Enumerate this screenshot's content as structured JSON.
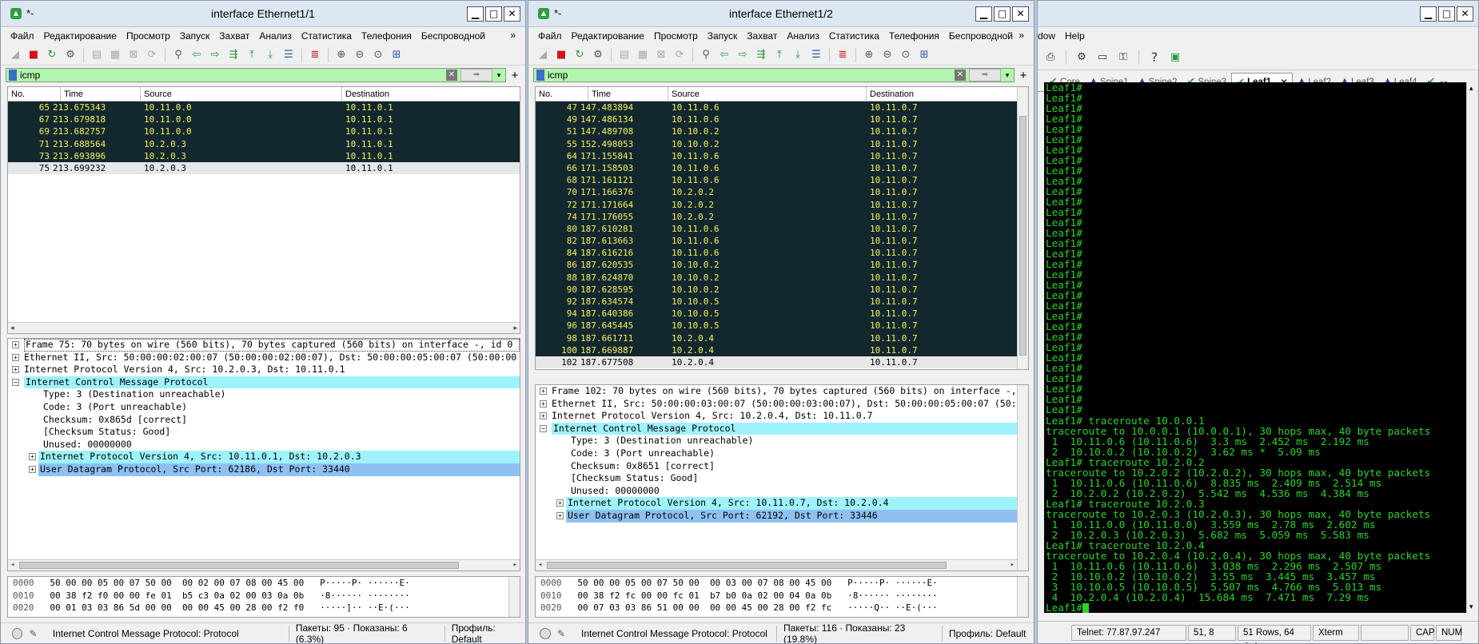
{
  "menu": [
    "Файл",
    "Редактирование",
    "Просмотр",
    "Запуск",
    "Захват",
    "Анализ",
    "Статистика",
    "Телефония",
    "Беспроводной"
  ],
  "columns": {
    "no": "No.",
    "time": "Time",
    "source": "Source",
    "destination": "Destination"
  },
  "win1": {
    "app_name": "*-",
    "title": "interface Ethernet1/1",
    "filter": "icmp",
    "packets": [
      {
        "no": "65",
        "time": "213.675343",
        "src": "10.11.0.0",
        "dst": "10.11.0.1",
        "style": "dark"
      },
      {
        "no": "67",
        "time": "213.679818",
        "src": "10.11.0.0",
        "dst": "10.11.0.1",
        "style": "dark"
      },
      {
        "no": "69",
        "time": "213.682757",
        "src": "10.11.0.0",
        "dst": "10.11.0.1",
        "style": "dark"
      },
      {
        "no": "71",
        "time": "213.688564",
        "src": "10.2.0.3",
        "dst": "10.11.0.1",
        "style": "dark"
      },
      {
        "no": "73",
        "time": "213.693896",
        "src": "10.2.0.3",
        "dst": "10.11.0.1",
        "style": "dark"
      },
      {
        "no": "75",
        "time": "213.699232",
        "src": "10.2.0.3",
        "dst": "10.11.0.1",
        "style": "sel"
      }
    ],
    "details": [
      {
        "text": "Frame 75: 70 bytes on wire (560 bits), 70 bytes captured (560 bits) on interface -, id 0",
        "level": "top",
        "expander": "+",
        "hl": "outline"
      },
      {
        "text": "Ethernet II, Src: 50:00:00:02:00:07 (50:00:00:02:00:07), Dst: 50:00:00:05:00:07 (50:00:00",
        "level": "top",
        "expander": "+",
        "hl": ""
      },
      {
        "text": "Internet Protocol Version 4, Src: 10.2.0.3, Dst: 10.11.0.1",
        "level": "top",
        "expander": "+",
        "hl": ""
      },
      {
        "text": "Internet Control Message Protocol",
        "level": "top",
        "expander": "−",
        "hl": "cyan"
      },
      {
        "text": "Type: 3 (Destination unreachable)",
        "level": "child",
        "expander": "",
        "hl": ""
      },
      {
        "text": "Code: 3 (Port unreachable)",
        "level": "child",
        "expander": "",
        "hl": ""
      },
      {
        "text": "Checksum: 0x865d [correct]",
        "level": "child",
        "expander": "",
        "hl": ""
      },
      {
        "text": "[Checksum Status: Good]",
        "level": "child",
        "expander": "",
        "hl": ""
      },
      {
        "text": "Unused: 00000000",
        "level": "child",
        "expander": "",
        "hl": ""
      },
      {
        "text": "Internet Protocol Version 4, Src: 10.11.0.1, Dst: 10.2.0.3",
        "level": "child2",
        "expander": "+",
        "hl": "cyan"
      },
      {
        "text": "User Datagram Protocol, Src Port: 62186, Dst Port: 33440",
        "level": "child2",
        "expander": "+",
        "hl": "blue"
      }
    ],
    "hex": [
      {
        "off": "0000",
        "bytes": "50 00 00 05 00 07 50 00  00 02 00 07 08 00 45 00",
        "ascii": "P·····P· ······E·"
      },
      {
        "off": "0010",
        "bytes": "00 38 f2 f0 00 00 fe 01  b5 c3 0a 02 00 03 0a 0b",
        "ascii": "·8······ ········"
      },
      {
        "off": "0020",
        "bytes": "00 01 03 03 86 5d 00 00  00 00 45 00 28 00 f2 f0",
        "ascii": "·····]·· ··E·(···"
      }
    ],
    "status": {
      "field": "Internet Control Message Protocol: Protocol",
      "packets": "Пакеты: 95 · Показаны: 6 (6.3%)",
      "profile": "Профиль: Default"
    }
  },
  "win2": {
    "app_name": "*-",
    "title": "interface Ethernet1/2",
    "filter": "icmp",
    "packets": [
      {
        "no": "47",
        "time": "147.483894",
        "src": "10.11.0.6",
        "dst": "10.11.0.7",
        "style": "dark"
      },
      {
        "no": "49",
        "time": "147.486134",
        "src": "10.11.0.6",
        "dst": "10.11.0.7",
        "style": "dark"
      },
      {
        "no": "51",
        "time": "147.489708",
        "src": "10.10.0.2",
        "dst": "10.11.0.7",
        "style": "dark"
      },
      {
        "no": "55",
        "time": "152.498053",
        "src": "10.10.0.2",
        "dst": "10.11.0.7",
        "style": "dark"
      },
      {
        "no": "64",
        "time": "171.155841",
        "src": "10.11.0.6",
        "dst": "10.11.0.7",
        "style": "dark"
      },
      {
        "no": "66",
        "time": "171.158503",
        "src": "10.11.0.6",
        "dst": "10.11.0.7",
        "style": "dark"
      },
      {
        "no": "68",
        "time": "171.161121",
        "src": "10.11.0.6",
        "dst": "10.11.0.7",
        "style": "dark"
      },
      {
        "no": "70",
        "time": "171.166376",
        "src": "10.2.0.2",
        "dst": "10.11.0.7",
        "style": "dark"
      },
      {
        "no": "72",
        "time": "171.171664",
        "src": "10.2.0.2",
        "dst": "10.11.0.7",
        "style": "dark"
      },
      {
        "no": "74",
        "time": "171.176055",
        "src": "10.2.0.2",
        "dst": "10.11.0.7",
        "style": "dark"
      },
      {
        "no": "80",
        "time": "187.610281",
        "src": "10.11.0.6",
        "dst": "10.11.0.7",
        "style": "dark"
      },
      {
        "no": "82",
        "time": "187.613663",
        "src": "10.11.0.6",
        "dst": "10.11.0.7",
        "style": "dark"
      },
      {
        "no": "84",
        "time": "187.616216",
        "src": "10.11.0.6",
        "dst": "10.11.0.7",
        "style": "dark"
      },
      {
        "no": "86",
        "time": "187.620535",
        "src": "10.10.0.2",
        "dst": "10.11.0.7",
        "style": "dark"
      },
      {
        "no": "88",
        "time": "187.624870",
        "src": "10.10.0.2",
        "dst": "10.11.0.7",
        "style": "dark"
      },
      {
        "no": "90",
        "time": "187.628595",
        "src": "10.10.0.2",
        "dst": "10.11.0.7",
        "style": "dark"
      },
      {
        "no": "92",
        "time": "187.634574",
        "src": "10.10.0.5",
        "dst": "10.11.0.7",
        "style": "dark"
      },
      {
        "no": "94",
        "time": "187.640386",
        "src": "10.10.0.5",
        "dst": "10.11.0.7",
        "style": "dark"
      },
      {
        "no": "96",
        "time": "187.645445",
        "src": "10.10.0.5",
        "dst": "10.11.0.7",
        "style": "dark"
      },
      {
        "no": "98",
        "time": "187.661711",
        "src": "10.2.0.4",
        "dst": "10.11.0.7",
        "style": "dark"
      },
      {
        "no": "100",
        "time": "187.669887",
        "src": "10.2.0.4",
        "dst": "10.11.0.7",
        "style": "dark"
      },
      {
        "no": "102",
        "time": "187.677508",
        "src": "10.2.0.4",
        "dst": "10.11.0.7",
        "style": "sel"
      }
    ],
    "details": [
      {
        "text": "Frame 102: 70 bytes on wire (560 bits), 70 bytes captured (560 bits) on interface -, i",
        "level": "top",
        "expander": "+",
        "hl": ""
      },
      {
        "text": "Ethernet II, Src: 50:00:00:03:00:07 (50:00:00:03:00:07), Dst: 50:00:00:05:00:07 (50:00",
        "level": "top",
        "expander": "+",
        "hl": ""
      },
      {
        "text": "Internet Protocol Version 4, Src: 10.2.0.4, Dst: 10.11.0.7",
        "level": "top",
        "expander": "+",
        "hl": ""
      },
      {
        "text": "Internet Control Message Protocol",
        "level": "top",
        "expander": "−",
        "hl": "cyan"
      },
      {
        "text": "Type: 3 (Destination unreachable)",
        "level": "child",
        "expander": "",
        "hl": ""
      },
      {
        "text": "Code: 3 (Port unreachable)",
        "level": "child",
        "expander": "",
        "hl": ""
      },
      {
        "text": "Checksum: 0x8651 [correct]",
        "level": "child",
        "expander": "",
        "hl": ""
      },
      {
        "text": "[Checksum Status: Good]",
        "level": "child",
        "expander": "",
        "hl": ""
      },
      {
        "text": "Unused: 00000000",
        "level": "child",
        "expander": "",
        "hl": ""
      },
      {
        "text": "Internet Protocol Version 4, Src: 10.11.0.7, Dst: 10.2.0.4",
        "level": "child2",
        "expander": "+",
        "hl": "cyan"
      },
      {
        "text": "User Datagram Protocol, Src Port: 62192, Dst Port: 33446",
        "level": "child2",
        "expander": "+",
        "hl": "blue"
      }
    ],
    "hex": [
      {
        "off": "0000",
        "bytes": "50 00 00 05 00 07 50 00  00 03 00 07 08 00 45 00",
        "ascii": "P·····P· ······E·"
      },
      {
        "off": "0010",
        "bytes": "00 38 f2 fc 00 00 fc 01  b7 b0 0a 02 00 04 0a 0b",
        "ascii": "·8······ ········"
      },
      {
        "off": "0020",
        "bytes": "00 07 03 03 86 51 00 00  00 00 45 00 28 00 f2 fc",
        "ascii": "·····Q·· ··E·(···"
      }
    ],
    "status": {
      "field": "Internet Control Message Protocol: Protocol",
      "packets": "Пакеты: 116 · Показаны: 23 (19.8%)",
      "profile": "Профиль: Default"
    }
  },
  "terminal_win": {
    "menu": [
      "dow",
      "Help"
    ],
    "tabs": [
      {
        "label": "Core",
        "status": "ok",
        "active": false
      },
      {
        "label": "Spine1",
        "status": "warn",
        "active": false
      },
      {
        "label": "Spine2",
        "status": "warn",
        "active": false
      },
      {
        "label": "Spine3",
        "status": "ok",
        "active": false
      },
      {
        "label": "Leaf1",
        "status": "ok",
        "active": true
      },
      {
        "label": "Leaf2",
        "status": "warn",
        "active": false
      },
      {
        "label": "Leaf3",
        "status": "warn",
        "active": false
      },
      {
        "label": "Leaf4",
        "status": "warn",
        "active": false
      }
    ],
    "prompt_repeat_count": 32,
    "prompt": "Leaf1#",
    "lines": [
      "Leaf1# traceroute 10.0.0.1",
      "traceroute to 10.0.0.1 (10.0.0.1), 30 hops max, 40 byte packets",
      " 1  10.11.0.6 (10.11.0.6)  3.3 ms  2.452 ms  2.192 ms",
      " 2  10.10.0.2 (10.10.0.2)  3.62 ms *  5.09 ms",
      "Leaf1# traceroute 10.2.0.2",
      "traceroute to 10.2.0.2 (10.2.0.2), 30 hops max, 40 byte packets",
      " 1  10.11.0.6 (10.11.0.6)  8.835 ms  2.409 ms  2.514 ms",
      " 2  10.2.0.2 (10.2.0.2)  5.542 ms  4.536 ms  4.384 ms",
      "Leaf1# traceroute 10.2.0.3",
      "traceroute to 10.2.0.3 (10.2.0.3), 30 hops max, 40 byte packets",
      " 1  10.11.0.0 (10.11.0.0)  3.559 ms  2.78 ms  2.602 ms",
      " 2  10.2.0.3 (10.2.0.3)  5.682 ms  5.059 ms  5.583 ms",
      "Leaf1# traceroute 10.2.0.4",
      "traceroute to 10.2.0.4 (10.2.0.4), 30 hops max, 40 byte packets",
      " 1  10.11.0.6 (10.11.0.6)  3.038 ms  2.296 ms  2.507 ms",
      " 2  10.10.0.2 (10.10.0.2)  3.55 ms  3.445 ms  3.457 ms",
      " 3  10.10.0.5 (10.10.0.5)  5.507 ms  4.766 ms  5.013 ms",
      " 4  10.2.0.4 (10.2.0.4)  15.684 ms  7.471 ms  7.29 ms",
      "Leaf1#"
    ],
    "status": {
      "telnet": "Telnet: 77.87.97.247",
      "pos": "51,  8",
      "size": "51 Rows, 64 Cols",
      "term": "Xterm",
      "cap": "CAP",
      "num": "NUM"
    }
  }
}
